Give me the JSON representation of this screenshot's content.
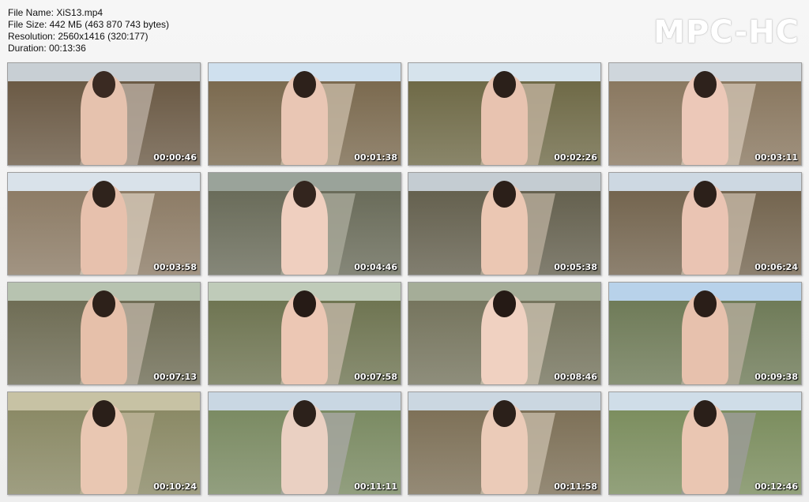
{
  "file_info": {
    "file_name": "File Name: XiS13.mp4",
    "file_size": "File Size: 442 МБ (463 870 743 bytes)",
    "resolution": "Resolution: 2560x1416 (320:177)",
    "duration": "Duration: 00:13:36"
  },
  "logo": "MPC-HC",
  "thumbnails": [
    {
      "time": "00:00:46",
      "sky": "#c8cfd4",
      "field": "#6b5a45",
      "road": "#b9ada0",
      "figure": "#e6c2ae",
      "head": "#3a2a22"
    },
    {
      "time": "00:01:38",
      "sky": "#cfe0ee",
      "field": "#7b6a4f",
      "road": "#c7b9a5",
      "figure": "#e9c6b4",
      "head": "#2d211b"
    },
    {
      "time": "00:02:26",
      "sky": "#d6e3ec",
      "field": "#6f6a47",
      "road": "#c0b29e",
      "figure": "#e8c3b0",
      "head": "#2b201a"
    },
    {
      "time": "00:03:11",
      "sky": "#cfd6dc",
      "field": "#8a7860",
      "road": "#cfc2b2",
      "figure": "#ecc8b8",
      "head": "#2e221c"
    },
    {
      "time": "00:03:58",
      "sky": "#d9e2ea",
      "field": "#8d7c66",
      "road": "#d5c8b8",
      "figure": "#e7c1ad",
      "head": "#2f231c"
    },
    {
      "time": "00:04:46",
      "sky": "#9aa39a",
      "field": "#6a6c5a",
      "road": "#a9a99a",
      "figure": "#efcfbf",
      "head": "#33251e"
    },
    {
      "time": "00:05:38",
      "sky": "#c4ccd2",
      "field": "#65614f",
      "road": "#b8ad9b",
      "figure": "#ebc7b3",
      "head": "#2b1f19"
    },
    {
      "time": "00:06:24",
      "sky": "#cdd8e2",
      "field": "#74654f",
      "road": "#c6b8a6",
      "figure": "#eac4b3",
      "head": "#2c201a"
    },
    {
      "time": "00:07:13",
      "sky": "#b7c3b0",
      "field": "#6f6d55",
      "road": "#bcb2a3",
      "figure": "#e6c0aa",
      "head": "#2d211a"
    },
    {
      "time": "00:07:58",
      "sky": "#bfcbb9",
      "field": "#6f7552",
      "road": "#c2b7a6",
      "figure": "#ecc7b4",
      "head": "#261b16"
    },
    {
      "time": "00:08:46",
      "sky": "#a5ad98",
      "field": "#76755e",
      "road": "#c9bfae",
      "figure": "#f0d1c1",
      "head": "#251a15"
    },
    {
      "time": "00:09:38",
      "sky": "#b8d2ea",
      "field": "#6f7b58",
      "road": "#b5ac9c",
      "figure": "#e7c1ad",
      "head": "#2a1e18"
    },
    {
      "time": "00:10:24",
      "sky": "#c7c2a4",
      "field": "#8b8a66",
      "road": "#bfb59b",
      "figure": "#e9c7b2",
      "head": "#2a1f19"
    },
    {
      "time": "00:11:11",
      "sky": "#c9d7e3",
      "field": "#7b8b63",
      "road": "#a8a7a2",
      "figure": "#ead0c2",
      "head": "#2c211b"
    },
    {
      "time": "00:11:58",
      "sky": "#cbd7e1",
      "field": "#7e7158",
      "road": "#c6baa8",
      "figure": "#ebcbb8",
      "head": "#2b201a"
    },
    {
      "time": "00:12:46",
      "sky": "#cfdde8",
      "field": "#7c8e5f",
      "road": "#9c9c98",
      "figure": "#eac6b2",
      "head": "#2a1f19"
    }
  ]
}
